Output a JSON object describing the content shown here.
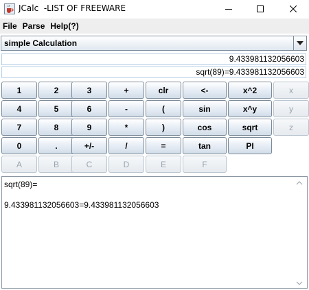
{
  "window": {
    "title": "JCalc  -LIST OF FREEWARE",
    "icons": {
      "app": "coffee-cup-icon",
      "minimize": "minimize-icon",
      "maximize": "maximize-icon",
      "close": "close-icon"
    }
  },
  "menu": [
    "File",
    "Parse",
    "Help(?)"
  ],
  "mode_select": {
    "value": "simple Calculation",
    "icon": "chevron-down-icon"
  },
  "display": {
    "result": "9.433981132056603",
    "expression": "sqrt(89)=9.433981132056603"
  },
  "keypad": {
    "row1": [
      "1",
      "2",
      "3",
      "+",
      "clr",
      "<-",
      "x^2",
      "x"
    ],
    "row2": [
      "4",
      "5",
      "6",
      "-",
      "(",
      "sin",
      "x^y",
      "y"
    ],
    "row3": [
      "7",
      "8",
      "9",
      "*",
      ")",
      "cos",
      "sqrt",
      "z"
    ],
    "row4": [
      "0",
      ".",
      "+/-",
      "/",
      "=",
      "tan",
      "PI"
    ],
    "row5": [
      "A",
      "B",
      "C",
      "D",
      "E",
      "F"
    ]
  },
  "history": {
    "line1": "sqrt(89)=",
    "line2": "9.433981132056603=9.433981132056603"
  }
}
